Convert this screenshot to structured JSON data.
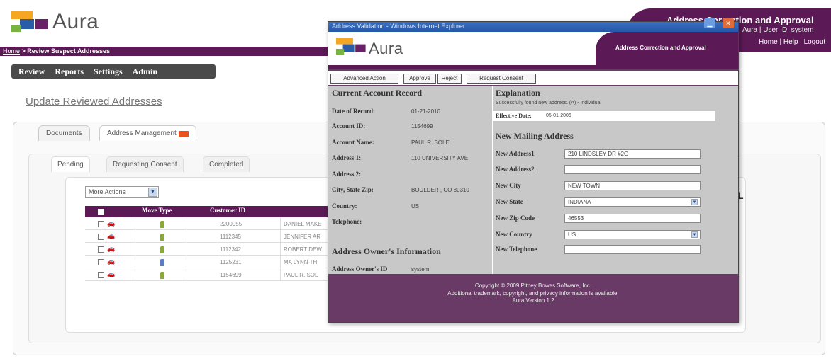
{
  "app": {
    "logo_text": "Aura",
    "banner_title": "Address Correction and Approval",
    "banner_user": "Aura | User ID: system",
    "links": [
      "Home",
      "Help",
      "Logout"
    ],
    "breadcrumb_home": "Home",
    "breadcrumb_current": "Review Suspect Addresses",
    "nav": [
      "Review",
      "Reports",
      "Settings",
      "Admin"
    ],
    "page_title": "Update Reviewed Addresses",
    "tabs": [
      "Documents",
      "Address Management"
    ],
    "subtabs": [
      "Pending",
      "Requesting Consent",
      "Completed"
    ],
    "more_actions": "More Actions",
    "grid": {
      "headers": [
        "Move Type",
        "Customer ID"
      ],
      "rows": [
        {
          "move": "person",
          "id": "2200055",
          "name": "DANIEL MAKE"
        },
        {
          "move": "person",
          "id": "1112345",
          "name": "JENNIFER AR"
        },
        {
          "move": "person",
          "id": "1112342",
          "name": "ROBERT DEW"
        },
        {
          "move": "document",
          "id": "1125231",
          "name": "MA LYNN TH"
        },
        {
          "move": "person",
          "id": "1154699",
          "name": "PAUL R. SOL"
        }
      ]
    }
  },
  "popup": {
    "window_title": "Address Validation - Windows Internet Explorer",
    "logo_text": "Aura",
    "banner_title": "Address Correction and Approval",
    "buttons": [
      "Advanced Action",
      "Approve",
      "Reject",
      "Request Consent"
    ],
    "current_record": {
      "title": "Current Account Record",
      "fields": [
        {
          "label": "Date of Record:",
          "value": "01-21-2010"
        },
        {
          "label": "Account ID:",
          "value": "1154699"
        },
        {
          "label": "Account Name:",
          "value": "PAUL R. SOLE"
        },
        {
          "label": "Address 1:",
          "value": "110 UNIVERSITY AVE"
        },
        {
          "label": "Address 2:",
          "value": ""
        },
        {
          "label": "City, State Zip:",
          "value": "BOULDER , CO 80310"
        },
        {
          "label": "Country:",
          "value": "US"
        },
        {
          "label": "Telephone:",
          "value": ""
        }
      ]
    },
    "owner": {
      "title": "Address Owner's Information",
      "id_label": "Address Owner's ID",
      "id_value": "system"
    },
    "explanation": {
      "title": "Explanation",
      "text": "Successfully found new address. (A) - Individual",
      "effective_label": "Effective Date:",
      "effective_value": "05-01-2006"
    },
    "new_address": {
      "title": "New Mailing Address",
      "fields": [
        {
          "label": "New Address1",
          "value": "210 LINDSLEY DR #2G",
          "kind": "input"
        },
        {
          "label": "New Address2",
          "value": "",
          "kind": "input"
        },
        {
          "label": "New City",
          "value": "NEW TOWN",
          "kind": "input"
        },
        {
          "label": "New State",
          "value": "INDIANA",
          "kind": "select"
        },
        {
          "label": "New Zip Code",
          "value": "46553",
          "kind": "input"
        },
        {
          "label": "New Country",
          "value": "US",
          "kind": "select"
        },
        {
          "label": "New Telephone",
          "value": "",
          "kind": "input"
        }
      ]
    },
    "footer": [
      "Copyright © 2009 Pitney Bowes Software, Inc.",
      "Additional trademark, copyright, and privacy information is available.",
      "Aura Version 1.2"
    ]
  },
  "colors": {
    "brand_purple": "#5b1a56",
    "nav_dark": "#4a4a4a",
    "panel_gray": "#c8c8c8",
    "titlebar_blue": "#2457a8"
  }
}
